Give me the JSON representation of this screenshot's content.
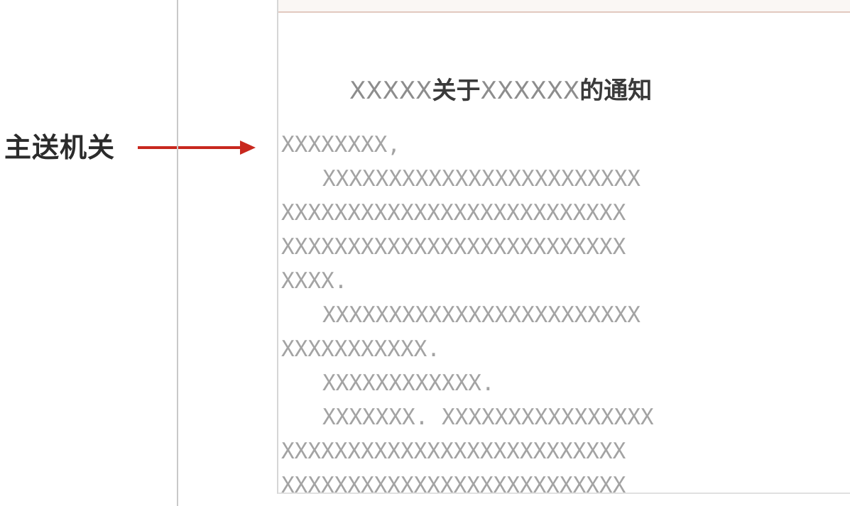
{
  "annotation": {
    "label": "主送机关"
  },
  "document": {
    "title_part1": "XXXXX",
    "title_part2": "关于",
    "title_part3": "XXXXXX",
    "title_part4": "的通知",
    "lines": [
      "XXXXXXXX,",
      "XXXXXXXXXXXXXXXXXXXXXXXX",
      "XXXXXXXXXXXXXXXXXXXXXXXXXX",
      "XXXXXXXXXXXXXXXXXXXXXXXXXX",
      "XXXX.",
      "XXXXXXXXXXXXXXXXXXXXXXXX",
      "XXXXXXXXXXX.",
      "XXXXXXXXXXXX.",
      "XXXXXXX. XXXXXXXXXXXXXXXX",
      "XXXXXXXXXXXXXXXXXXXXXXXXXX",
      "XXXXXXXXXXXXXXXXXXXXXXXXXX"
    ]
  },
  "colors": {
    "arrow": "#c8281e",
    "placeholder_text": "#a3a3a3",
    "label_text": "#2b2b2b"
  }
}
